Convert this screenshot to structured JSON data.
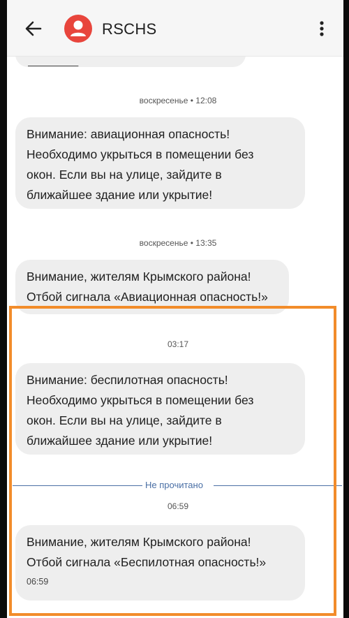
{
  "header": {
    "title": "RSCHS",
    "avatar_color": "#e8453c"
  },
  "messages": [
    {
      "timestamp": "воскресенье • 12:08",
      "text": "Внимание: авиационная опасность!\nНеобходимо укрыться в помещении без\nокон. Если вы на улице, зайдите в\nближайшее здание или укрытие!"
    },
    {
      "timestamp": "воскресенье • 13:35",
      "text": "Внимание, жителям Крымского района!\nОтбой сигнала «Авиационная опасность!»"
    },
    {
      "timestamp": "03:17",
      "text": "Внимание: беспилотная опасность!\nНеобходимо укрыться в помещении без\nокон. Если вы на улице, зайдите в\nближайшее здание или укрытие!"
    },
    {
      "timestamp": "06:59",
      "text": "Внимание, жителям Крымского района!\nОтбой сигнала «Беспилотная опасность!»",
      "time_inline": "06:59"
    }
  ],
  "unread_divider": "Не прочитано",
  "highlight_color": "#f28c2a"
}
